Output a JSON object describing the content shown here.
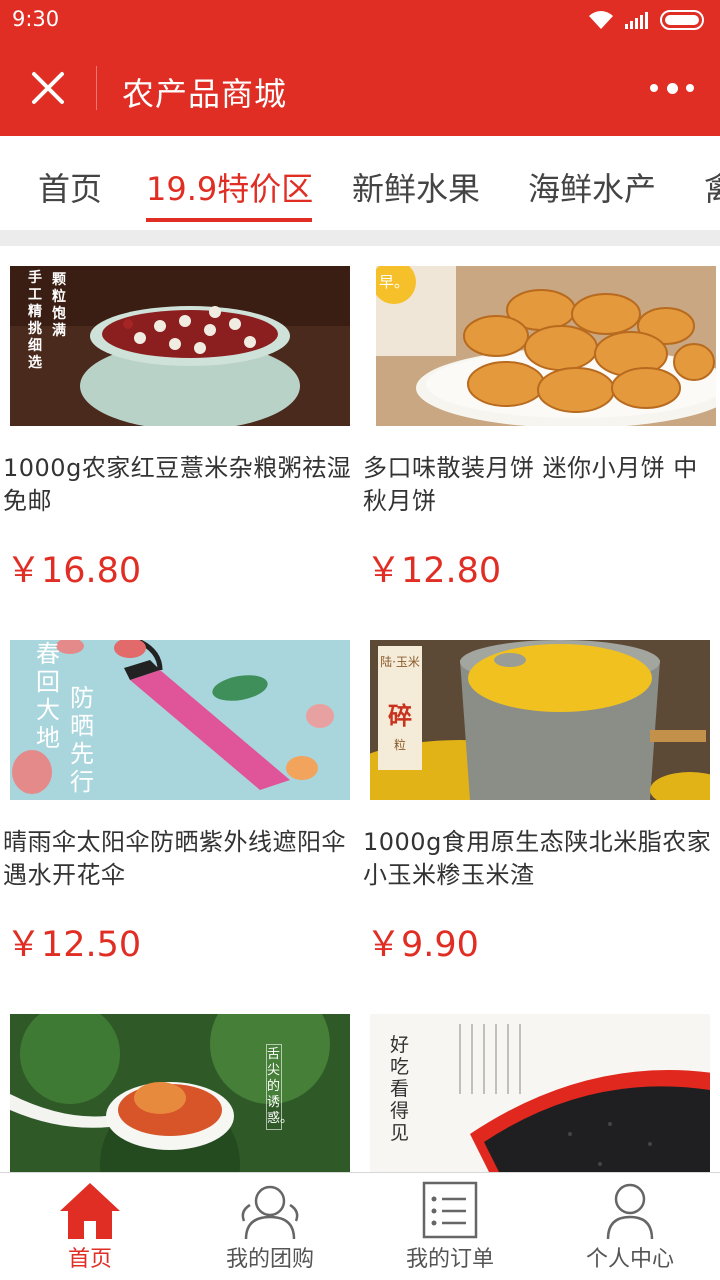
{
  "status_bar": {
    "time": "9:30"
  },
  "header": {
    "title": "农产品商城",
    "close_icon": "close-icon",
    "more_icon": "more-dots-icon"
  },
  "colors": {
    "brand": "#e02e24",
    "text": "#333333",
    "price": "#e02e24"
  },
  "tabs": [
    {
      "label": "首页"
    },
    {
      "label": "19.9特价区",
      "active": true
    },
    {
      "label": "新鲜水果"
    },
    {
      "label": "海鲜水产"
    },
    {
      "label": "禽"
    }
  ],
  "products": [
    {
      "name": "1000g农家红豆薏米杂粮粥祛湿免邮",
      "price": "￥16.80",
      "image_text": {
        "line1": "颗粒饱满",
        "line2": "手工精挑细选"
      }
    },
    {
      "name": "多口味散装月饼 迷你小月饼 中秋月饼",
      "price": "￥12.80",
      "image_text": {
        "badge": "早。"
      }
    },
    {
      "name": "晴雨伞太阳伞防晒紫外线遮阳伞遇水开花伞",
      "price": "￥12.50",
      "image_text": {
        "line1": "春回大地",
        "line2": "防晒先行"
      }
    },
    {
      "name": "1000g食用原生态陕北米脂农家小玉米糁玉米渣",
      "price": "￥9.90",
      "image_text": {
        "line1": "陆·玉米",
        "big": "碎",
        "small": "粒"
      }
    },
    {
      "name": "",
      "price": "",
      "image_text": {
        "line1": "舌尖的诱惑。"
      }
    },
    {
      "name": "",
      "price": "",
      "image_text": {
        "line1": "好吃看得见"
      }
    }
  ],
  "bottom_nav": [
    {
      "label": "首页",
      "icon": "home-icon",
      "active": true
    },
    {
      "label": "我的团购",
      "icon": "group-icon"
    },
    {
      "label": "我的订单",
      "icon": "order-list-icon"
    },
    {
      "label": "个人中心",
      "icon": "user-icon"
    }
  ]
}
